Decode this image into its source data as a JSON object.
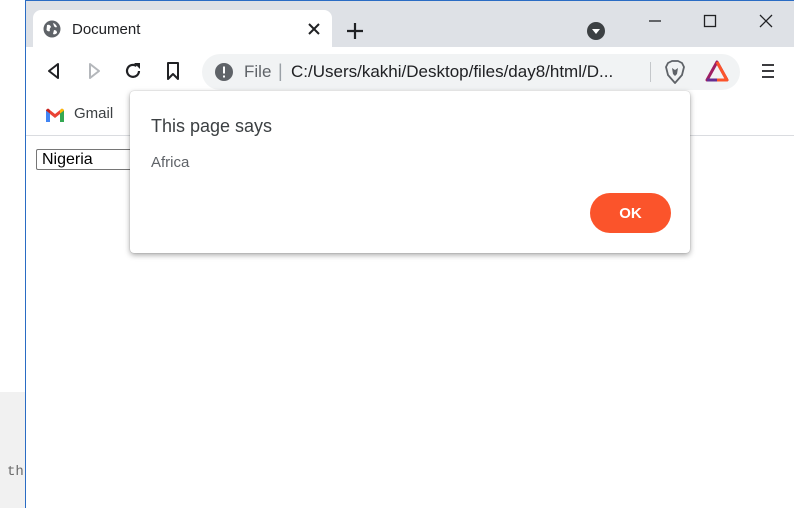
{
  "background_editor": {
    "code_snippet": "th"
  },
  "browser": {
    "tab": {
      "title": "Document"
    },
    "address_bar": {
      "scheme_label": "File",
      "separator": "|",
      "url": "C:/Users/kakhi/Desktop/files/day8/html/D..."
    },
    "bookmarks": [
      {
        "label": "Gmail"
      }
    ],
    "accent_color": "#fb542b"
  },
  "page": {
    "select": {
      "selected": "Nigeria"
    }
  },
  "dialog": {
    "title": "This page says",
    "message": "Africa",
    "ok_label": "OK"
  }
}
